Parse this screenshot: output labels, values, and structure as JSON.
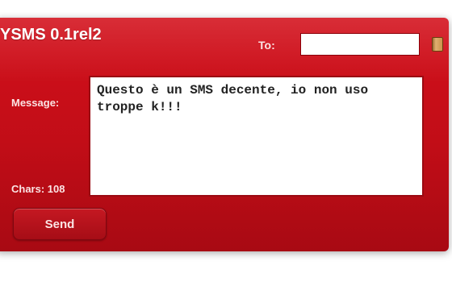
{
  "app": {
    "title": "YSMS 0.1rel2",
    "background_color": "#c10d17"
  },
  "recipient": {
    "label": "To:",
    "value": "",
    "contacts_icon": "address-book-icon"
  },
  "message": {
    "label": "Message:",
    "text": "Questo è un SMS decente, io non uso troppe k!!!"
  },
  "counter": {
    "text": "Chars: 108"
  },
  "actions": {
    "send_label": "Send"
  }
}
